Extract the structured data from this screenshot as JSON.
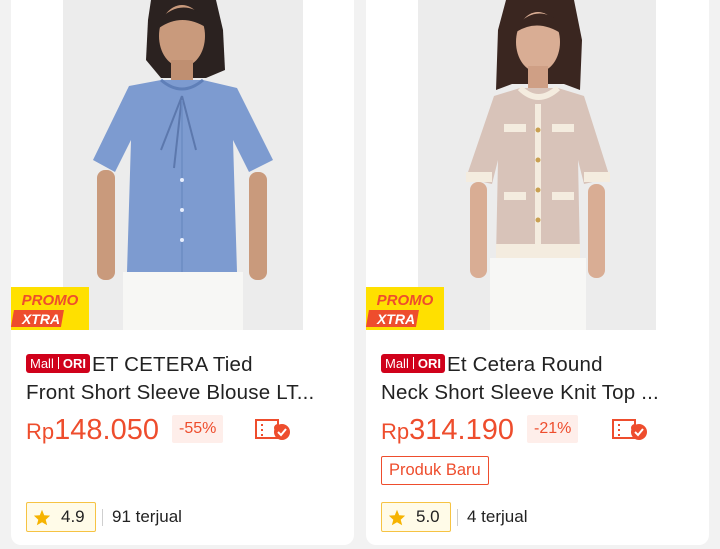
{
  "products": [
    {
      "promo_line1": "PROMO",
      "promo_line2": "XTRA",
      "badge_mall": "Mall",
      "badge_ori": "ORI",
      "title_line1": "ET CETERA Tied",
      "title_line2": "Front Short Sleeve Blouse LT...",
      "currency": "Rp",
      "price": "148.050",
      "discount": "-55%",
      "new_badge": "",
      "rating": "4.9",
      "sold": "91 terjual",
      "image_name": "woman-blue-blouse-photo"
    },
    {
      "promo_line1": "PROMO",
      "promo_line2": "XTRA",
      "badge_mall": "Mall",
      "badge_ori": "ORI",
      "title_line1": "Et Cetera Round",
      "title_line2": "Neck Short Sleeve Knit Top ...",
      "currency": "Rp",
      "price": "314.190",
      "discount": "-21%",
      "new_badge": "Produk Baru",
      "rating": "5.0",
      "sold": "4 terjual",
      "image_name": "woman-knit-top-photo"
    }
  ],
  "colors": {
    "accent": "#ee4d2d",
    "mall_red": "#d0011b",
    "promo_yellow": "#ffe000",
    "rating_star": "#f6b300",
    "background": "#f2f2f2"
  },
  "icons": {
    "voucher": "voucher-check-icon",
    "star": "star-icon"
  }
}
